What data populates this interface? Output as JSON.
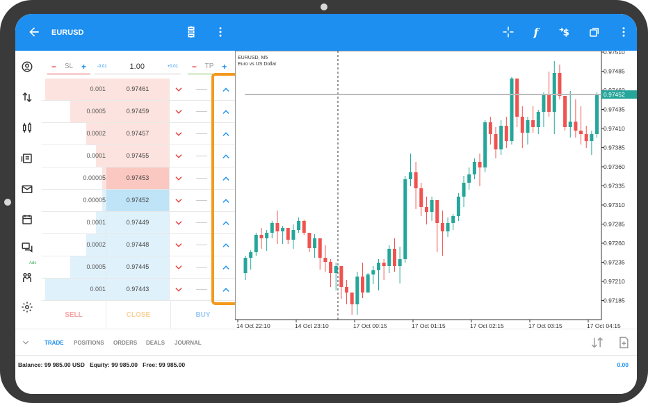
{
  "header": {
    "symbol": "EURUSD"
  },
  "order": {
    "sl_label": "SL",
    "tp_label": "TP",
    "minus": "−",
    "plus": "+",
    "volume": "1.00",
    "step_down": "-0.01",
    "step_up": "+0.01"
  },
  "dom_rows": [
    {
      "volume": "0.001",
      "price": "0.97461",
      "side": "ask",
      "depth": 0.95
    },
    {
      "volume": "0.0005",
      "price": "0.97459",
      "side": "ask",
      "depth": 0.55
    },
    {
      "volume": "0.0002",
      "price": "0.97457",
      "side": "ask",
      "depth": 0.3
    },
    {
      "volume": "0.0001",
      "price": "0.97455",
      "side": "ask",
      "depth": 0.15
    },
    {
      "volume": "0.00005",
      "price": "0.97453",
      "side": "ask",
      "depth": 0.05
    },
    {
      "volume": "0.00005",
      "price": "0.97452",
      "side": "bid",
      "depth": 0.05
    },
    {
      "volume": "0.0001",
      "price": "0.97449",
      "side": "bid",
      "depth": 0.15
    },
    {
      "volume": "0.0002",
      "price": "0.97448",
      "side": "bid",
      "depth": 0.3
    },
    {
      "volume": "0.0005",
      "price": "0.97445",
      "side": "bid",
      "depth": 0.55
    },
    {
      "volume": "0.001",
      "price": "0.97443",
      "side": "bid",
      "depth": 0.95
    }
  ],
  "actions": {
    "sell": "SELL",
    "close": "CLOSE",
    "buy": "BUY"
  },
  "chart": {
    "symbol_line": "EURUSD, M5",
    "desc_line": "Euro vs US Dollar",
    "current_price": "0.97452",
    "y_ticks": [
      "0.97510",
      "0.97485",
      "0.97460",
      "0.97435",
      "0.97410",
      "0.97385",
      "0.97360",
      "0.97335",
      "0.97310",
      "0.97285",
      "0.97260",
      "0.97235",
      "0.97210",
      "0.97185"
    ],
    "x_ticks": [
      "14 Oct 22:10",
      "14 Oct 23:10",
      "17 Oct 00:15",
      "17 Oct 01:15",
      "17 Oct 02:15",
      "17 Oct 03:15",
      "17 Oct 04:15"
    ]
  },
  "tabs": [
    "TRADE",
    "POSITIONS",
    "ORDERS",
    "DEALS",
    "JOURNAL"
  ],
  "balance": {
    "balance_label": "Balance:",
    "balance_value": "99 985.00 USD",
    "equity_label": "Equity:",
    "equity_value": "99 985.00",
    "free_label": "Free:",
    "free_value": "99 985.00",
    "profit": "0.00"
  },
  "sidebar": {
    "ads_label": "Ads"
  },
  "colors": {
    "accent": "#1d8ff0",
    "bull": "#26a69a",
    "bear": "#ef5350",
    "highlight": "#f39a1e"
  }
}
